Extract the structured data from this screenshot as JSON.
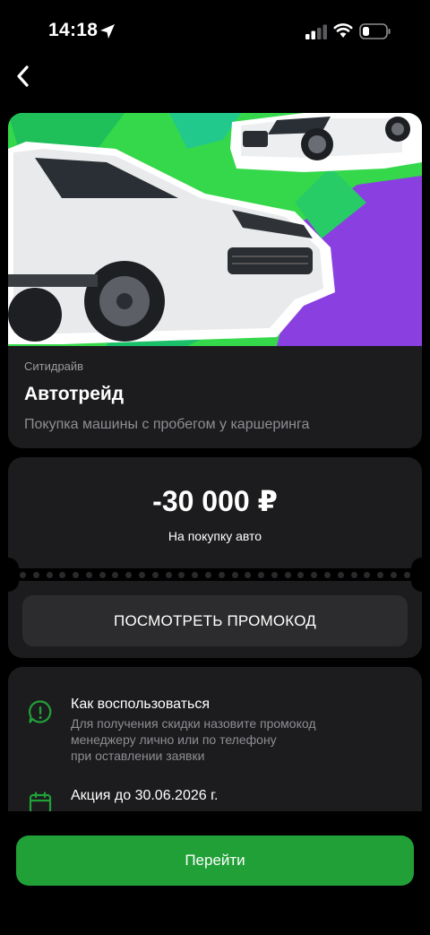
{
  "status_bar": {
    "time": "14:18"
  },
  "offer": {
    "brand": "Ситидрайв",
    "title": "Автотрейд",
    "description": "Покупка машины с пробегом у каршеринга"
  },
  "discount": {
    "amount": "-30 000 ₽",
    "caption": "На покупку авто",
    "promo_button": "ПОСМОТРЕТЬ ПРОМОКОД"
  },
  "info": {
    "how_to_title": "Как воспользоваться",
    "how_to_line1": "Для получения скидки назовите промокод",
    "how_to_line2": "менеджеру лично или по телефону",
    "how_to_line3": "при оставлении заявки",
    "deadline_title": "Акция до 30.06.2026 г."
  },
  "cta": {
    "label": "Перейти"
  },
  "colors": {
    "accent": "#21a038",
    "card": "#1c1c1e",
    "banner_green": "#3ee04a",
    "banner_purple": "#8a3fe0"
  }
}
